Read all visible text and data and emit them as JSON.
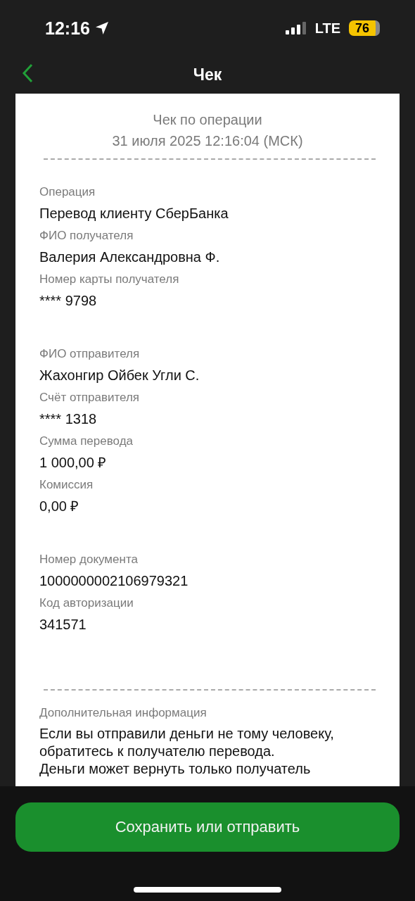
{
  "status_bar": {
    "time": "12:16",
    "network": "LTE",
    "battery": "76"
  },
  "nav": {
    "title": "Чек"
  },
  "receipt": {
    "title": "Чек по операции",
    "date": "31 июля 2025 12:16:04 (МСК)",
    "sections": [
      {
        "fields": [
          {
            "label": "Операция",
            "value": "Перевод клиенту СберБанка"
          },
          {
            "label": "ФИО получателя",
            "value": "Валерия Александровна Ф."
          },
          {
            "label": "Номер карты получателя",
            "value": "**** 9798"
          }
        ]
      },
      {
        "fields": [
          {
            "label": "ФИО отправителя",
            "value": "Жахонгир Ойбек Угли С."
          },
          {
            "label": "Счёт отправителя",
            "value": "**** 1318"
          },
          {
            "label": "Сумма перевода",
            "value": "1 000,00 ₽"
          },
          {
            "label": "Комиссия",
            "value": "0,00 ₽"
          }
        ]
      },
      {
        "fields": [
          {
            "label": "Номер документа",
            "value": "1000000002106979321"
          },
          {
            "label": "Код авторизации",
            "value": "341571"
          }
        ]
      }
    ],
    "additional": {
      "label": "Дополнительная информация",
      "lines": [
        "Если вы отправили деньги не тому человеку,",
        "обратитесь к получателю перевода.",
        "Деньги может вернуть только получатель"
      ]
    }
  },
  "action_button": "Сохранить или отправить"
}
